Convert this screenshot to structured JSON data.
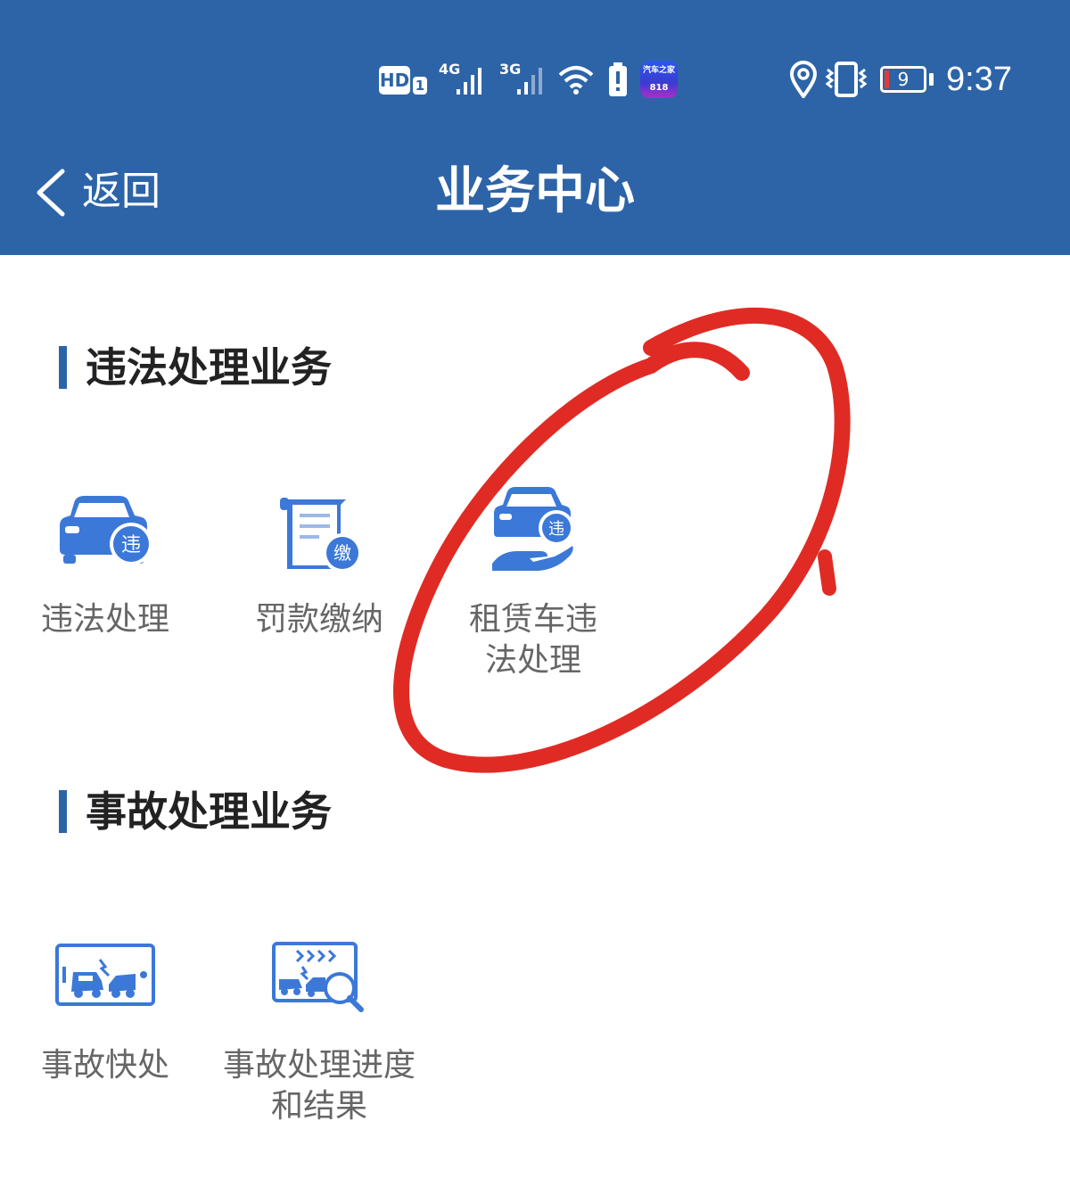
{
  "status_bar": {
    "hd": "HD",
    "hd_sub": "1",
    "net1": "4G",
    "net2": "3G",
    "app_icon_line1": "汽车之家",
    "app_icon_line2": "818",
    "battery": "9",
    "time": "9:37"
  },
  "nav": {
    "back_label": "返回",
    "title": "业务中心"
  },
  "sections": [
    {
      "title": "违法处理业务",
      "items": [
        {
          "label": "违法处理",
          "badge": "违",
          "icon": "car-violation-icon"
        },
        {
          "label": "罚款缴纳",
          "badge": "缴",
          "icon": "fine-document-icon"
        },
        {
          "label": "租赁车违法处理",
          "badge": "违",
          "icon": "rental-car-violation-icon"
        }
      ]
    },
    {
      "title": "事故处理业务",
      "items": [
        {
          "label": "事故快处",
          "icon": "accident-phone-icon"
        },
        {
          "label": "事故处理进度和结果",
          "icon": "accident-search-icon"
        }
      ]
    }
  ],
  "colors": {
    "brand": "#2d64a8",
    "icon_blue": "#3b78d8",
    "annotation": "#e02b24"
  }
}
